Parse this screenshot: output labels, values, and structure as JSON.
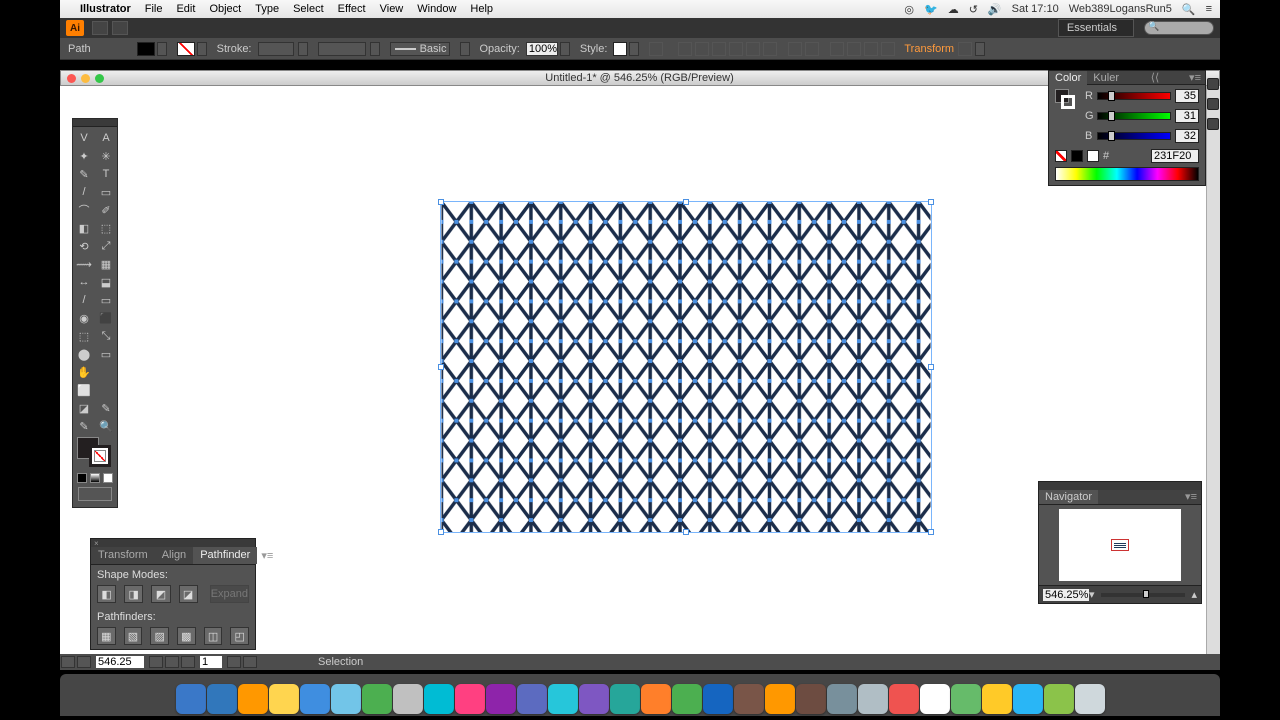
{
  "menubar": {
    "app": "Illustrator",
    "items": [
      "File",
      "Edit",
      "Object",
      "Type",
      "Select",
      "Effect",
      "View",
      "Window",
      "Help"
    ],
    "clock": "Sat 17:10",
    "user": "Web389LogansRun5"
  },
  "appbar": {
    "workspace": "Essentials"
  },
  "controlbar": {
    "context": "Path",
    "stroke_label": "Stroke:",
    "brush_label": "Basic",
    "opacity_label": "Opacity:",
    "opacity_value": "100%",
    "style_label": "Style:",
    "transform": "Transform"
  },
  "document": {
    "title": "Untitled-1* @ 546.25% (RGB/Preview)",
    "zoom": "546.25",
    "page": "1",
    "tool_status": "Selection"
  },
  "color": {
    "tab_color": "Color",
    "tab_kuler": "Kuler",
    "r": "35",
    "g": "31",
    "b": "32",
    "hex": "231F20"
  },
  "navigator": {
    "tab": "Navigator",
    "zoom": "546.25%"
  },
  "pathfinder": {
    "tab_transform": "Transform",
    "tab_align": "Align",
    "tab_pathfinder": "Pathfinder",
    "shape_modes": "Shape Modes:",
    "pathfinders": "Pathfinders:",
    "expand": "Expand"
  },
  "tools": [
    [
      "V",
      "A"
    ],
    [
      "✦",
      "✳"
    ],
    [
      "✎",
      "T"
    ],
    [
      "/",
      "▭"
    ],
    [
      "⌒",
      "✐"
    ],
    [
      "◧",
      "⬚"
    ],
    [
      "⟲",
      "⤢"
    ],
    [
      "⟿",
      "▦"
    ],
    [
      "↔",
      "⬓"
    ],
    [
      "/",
      "▭"
    ],
    [
      "◉",
      "⬛"
    ],
    [
      "⬚",
      "⤡"
    ],
    [
      "⬤",
      "▭"
    ],
    [
      "✋",
      ""
    ],
    [
      "⬜",
      ""
    ],
    [
      "◪",
      "✎"
    ],
    [
      "✎",
      "🔍"
    ]
  ],
  "dock_colors": [
    "#3a78c8",
    "#3177bb",
    "#ff9800",
    "#ffd54f",
    "#3f8ee0",
    "#72c5e8",
    "#4caf50",
    "#c0c0c0",
    "#00bcd4",
    "#ff4081",
    "#8e24aa",
    "#5c6bc0",
    "#26c6da",
    "#7e57c2",
    "#26a69a",
    "#ff7f2a",
    "#4caf50",
    "#1565c0",
    "#795548",
    "#ff9800",
    "#6d4c41",
    "#78909c",
    "#b0bec5",
    "#ef5350",
    "#fff",
    "#66bb6a",
    "#ffca28",
    "#29b6f6",
    "#8bc34a",
    "#cfd8dc"
  ]
}
